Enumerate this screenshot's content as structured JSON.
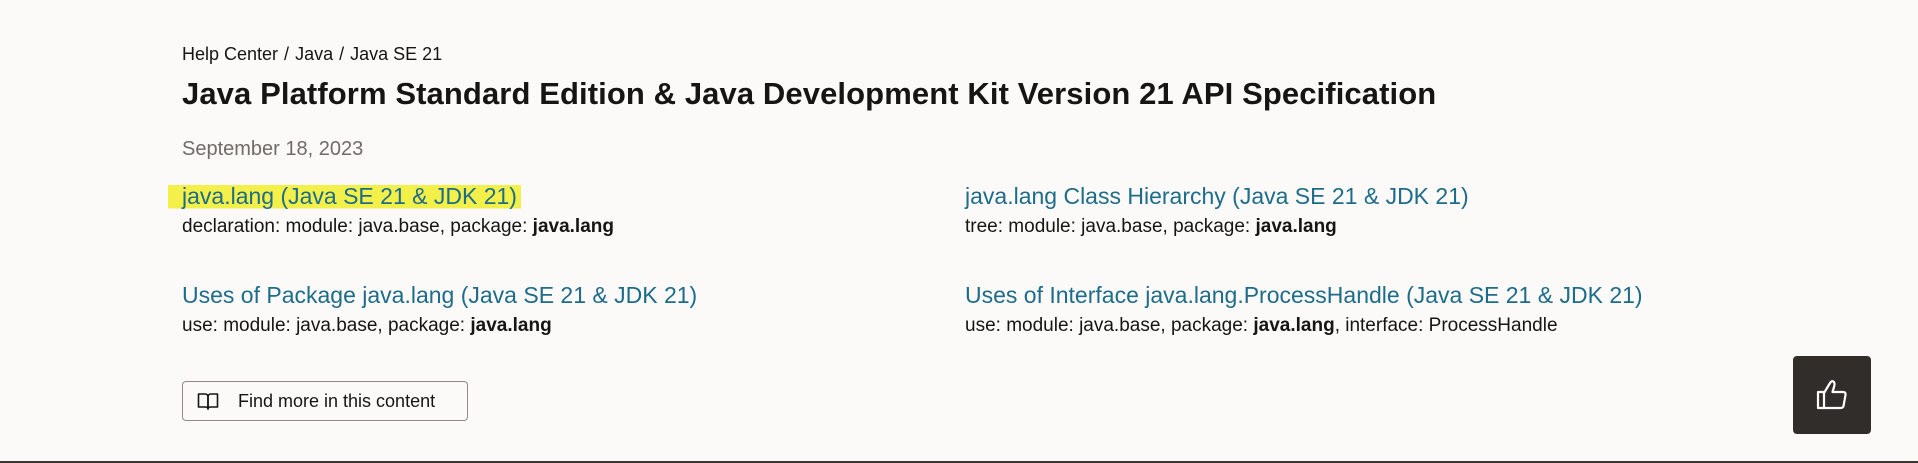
{
  "breadcrumb": {
    "items": [
      "Help Center",
      "Java",
      "Java SE 21"
    ],
    "separator": "/"
  },
  "page": {
    "title": "Java Platform Standard Edition & Java Development Kit Version 21 API Specification",
    "date": "September 18, 2023"
  },
  "results": [
    {
      "title": "java.lang (Java SE 21 & JDK 21)",
      "desc_prefix": "declaration: module: java.base, package: ",
      "desc_bold": "java.lang",
      "desc_suffix": "",
      "highlighted": true
    },
    {
      "title": "java.lang Class Hierarchy (Java SE 21 & JDK 21)",
      "desc_prefix": "tree: module: java.base, package: ",
      "desc_bold": "java.lang",
      "desc_suffix": "",
      "highlighted": false
    },
    {
      "title": "Uses of Package java.lang (Java SE 21 & JDK 21)",
      "desc_prefix": "use: module: java.base, package: ",
      "desc_bold": "java.lang",
      "desc_suffix": "",
      "highlighted": false
    },
    {
      "title": "Uses of Interface java.lang.ProcessHandle (Java SE 21 & JDK 21)",
      "desc_prefix": "use: module: java.base, package: ",
      "desc_bold": "java.lang",
      "desc_suffix": ", interface: ProcessHandle",
      "highlighted": false
    }
  ],
  "find_more": {
    "label": "Find more in this content",
    "icon": "book-open-icon"
  },
  "feedback": {
    "icon": "thumbs-up-icon"
  },
  "colors": {
    "background": "#fbfaf9",
    "link": "#1d6c8a",
    "highlight": "#f4f04a",
    "feedback_bg": "#312d2a",
    "muted": "#6f6b66"
  }
}
